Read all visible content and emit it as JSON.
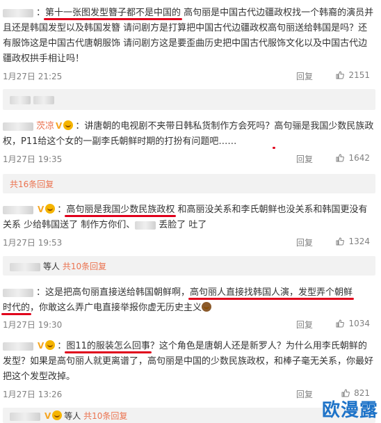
{
  "comments": [
    {
      "text_parts": [
        "：",
        "第十一张图发型簪子都不是中国的",
        " 高句丽是中国古代边疆政权找一个韩裔的演员并且还是韩国发型以及韩国发簪 请问剧方是打算把中国古代边疆政权高句丽送给韩国是吗？还有服饰这是中国古代唐朝服饰 请问剧方这是要歪曲历史把中国古代服饰文化以及中国古代边疆政权拱手相让吗！"
      ],
      "time": "1月27日 21:25",
      "reply": "回复",
      "likes": "2151"
    },
    {
      "user_suffix": "茨凉",
      "text_parts": [
        "：讲唐朝的电视剧不夹带日韩私货制作方会死吗？",
        "高句骊是我国少数民族政权，",
        "P11给这个女的一副李氏朝鲜时期的打扮有问题吧……"
      ],
      "time": "1月27日 19:35",
      "reply": "回复",
      "likes": "1642",
      "sub": "共16条回复"
    },
    {
      "text_parts": [
        "：",
        "高句丽是我国少数民族政权",
        " 和高丽没关系和李氏朝鲜也没关系和韩国更没有关系 少给韩国送了 制作方你们、",
        "丢脸了 吐了"
      ],
      "time": "1月27日 19:53",
      "reply": "回复",
      "likes": "1324",
      "sub_prefix": "等人",
      "sub": "共10条回复"
    },
    {
      "text_parts": [
        "：这是把高句丽直接送给韩国朝鲜啊，",
        "高句丽人直接找韩国人演，发型弄个朝鲜",
        "时代的",
        "，你敢这么弄广电直接举报你虚无历史主义"
      ],
      "time": "1月27日 19:30",
      "reply": "回复",
      "likes": "1034"
    },
    {
      "text_parts": [
        "：",
        "图11的服装怎么回事",
        "？这个角色是唐朝人还是新罗人？为什么用李氏朝鲜的发型？如果是高句丽人就更离谱了，高句丽是中国的少数民族政权，和棒子毫无关系，你最好把这个发型改掉。"
      ],
      "time": "1月27日 13:26",
      "reply": "回复",
      "likes": "821",
      "sub_prefix": "等人",
      "sub": "共10条回复"
    }
  ],
  "watermark": "欧漫露",
  "colors": {
    "link": "#eb7350",
    "underline": "#e0001b",
    "subbg": "#f2f2f2"
  }
}
